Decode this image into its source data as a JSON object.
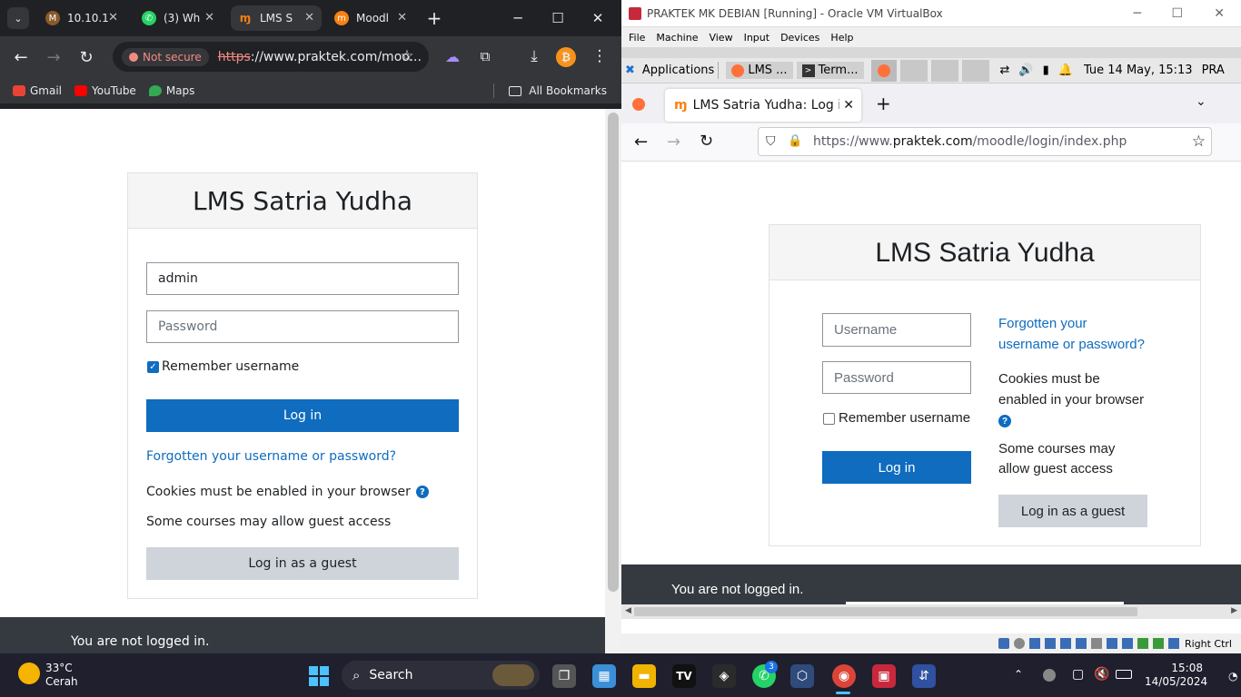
{
  "chrome": {
    "tabs": [
      {
        "label": "10.10.1",
        "icon": "mikrotik-icon"
      },
      {
        "label": "(3) Wh",
        "icon": "whatsapp-icon"
      },
      {
        "label": "LMS S",
        "icon": "moodle-icon"
      },
      {
        "label": "Moodl",
        "icon": "moodle-orange-icon"
      }
    ],
    "omnibox": {
      "security": "Not secure",
      "scheme": "https",
      "rest": "://www.praktek.com/moo..."
    },
    "bookmarks": [
      "Gmail",
      "YouTube",
      "Maps"
    ],
    "all_bookmarks": "All Bookmarks",
    "page": {
      "site_title": "LMS Satria Yudha",
      "username_value": "admin",
      "password_placeholder": "Password",
      "remember_label": "Remember username",
      "remember_checked": true,
      "login_button": "Log in",
      "forgot_link": "Forgotten your username or password?",
      "cookies_text": "Cookies must be enabled in your browser",
      "guest_text": "Some courses may allow guest access",
      "guest_button": "Log in as a guest",
      "footer": "You are not logged in."
    }
  },
  "vbox": {
    "title": "PRAKTEK MK DEBIAN [Running] - Oracle VM VirtualBox",
    "menu": [
      "File",
      "Machine",
      "View",
      "Input",
      "Devices",
      "Help"
    ],
    "xfce_panel": {
      "applications": "Applications",
      "tasks": [
        "LMS ...",
        "Term..."
      ],
      "clock": "Tue 14 May, 15:13",
      "user": "PRA"
    },
    "firefox": {
      "tab_title": "LMS Satria Yudha: Log in",
      "url_prefix": "https://www.",
      "url_domain": "praktek.com",
      "url_path": "/moodle/login/index.php"
    },
    "page": {
      "site_title": "LMS Satria Yudha",
      "username_placeholder": "Username",
      "password_placeholder": "Password",
      "remember_label": "Remember username",
      "login_button": "Log in",
      "forgot_link_1": "Forgotten your",
      "forgot_link_2": "username or password?",
      "cookies_1": "Cookies must be",
      "cookies_2": "enabled in your browser",
      "guest_1": "Some courses may",
      "guest_2": "allow guest access",
      "guest_button": "Log in as a guest",
      "footer": "You are not logged in."
    },
    "status_host_key": "Right Ctrl"
  },
  "taskbar": {
    "weather_temp": "33°C",
    "weather_desc": "Cerah",
    "search": "Search",
    "whatsapp_badge": "3",
    "time": "15:08",
    "date": "14/05/2024"
  }
}
